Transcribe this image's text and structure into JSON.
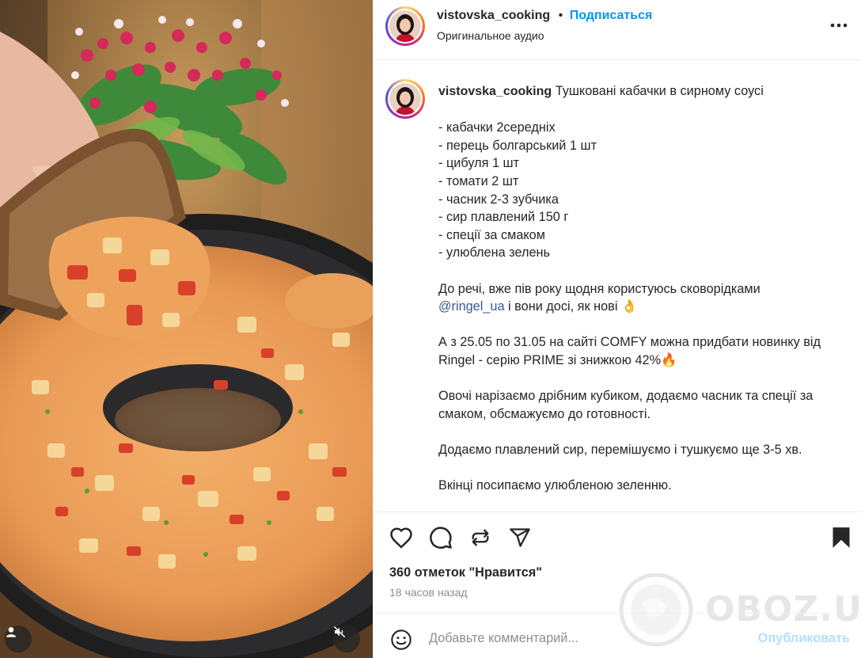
{
  "post": {
    "username": "vistovska_cooking",
    "separator": "•",
    "follow_label": "Подписаться",
    "audio_label": "Оригинальное аудио",
    "more_icon": "more-horizontal-icon"
  },
  "caption": {
    "username": "vistovska_cooking",
    "title": "Тушковані кабачки в сирному соусі",
    "ingredients": [
      "- кабачки 2середніх",
      "- перець болгарський 1 шт",
      "- цибуля 1 шт",
      "- томати 2 шт",
      "- часник 2-3 зубчика",
      "- сир плавлений 150 г",
      "- спеції за смаком",
      "- улюблена зелень"
    ],
    "para1_before": "До речі, вже пів року щодня користуюсь сковорідками",
    "mention": "@ringel_ua",
    "para1_after": " і вони досі, як нові 👌",
    "para2_line1": "А з 25.05 по 31.05 на сайті COMFY можна придбати новинку від",
    "para2_line2": "Ringel - серію PRIME зі знижкою 42%🔥",
    "para3_line1": "Овочі нарізаємо дрібним кубиком, додаємо часник та спеції за",
    "para3_line2": "смаком, обсмажуємо до готовності.",
    "para4": "Додаємо плавлений сир, перемішуємо і тушкуємо ще 3-5 хв.",
    "para5": "Вкінці посипаємо улюбленою зеленню."
  },
  "actions": {
    "likes": "360 отметок \"Нравится\"",
    "time": "18 часов назад",
    "icons": [
      "heart-icon",
      "comment-icon",
      "repost-icon",
      "share-icon",
      "bookmark-icon"
    ]
  },
  "comment": {
    "placeholder": "Добавьте комментарий...",
    "publish_label": "Опубликовать",
    "emoji_icon": "emoji-icon"
  },
  "media": {
    "user_icon": "user-tag-icon",
    "mute_icon": "muted-speaker-icon"
  },
  "watermark": {
    "text": "OBOZ.UA"
  },
  "colors": {
    "accent_blue": "#0095f6",
    "mention_blue": "#385898",
    "text": "#262626",
    "muted": "#8e8e8e"
  }
}
